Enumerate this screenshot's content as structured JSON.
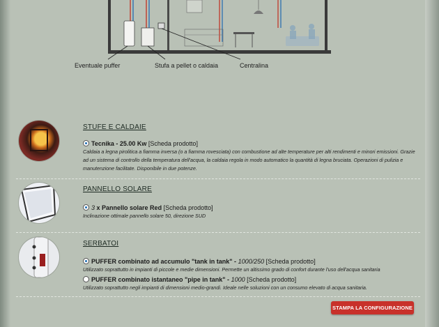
{
  "diagram": {
    "callouts": [
      "Eventuale puffer",
      "Stufa a pellet o caldaia",
      "Centralina"
    ]
  },
  "sections": [
    {
      "title": "STUFE E CALDAIE",
      "options": [
        {
          "selected": true,
          "name": "Tecnika - 25.00 Kw",
          "link": "[Scheda prodotto]",
          "description": "Caldaia a legna pirolitica a fiamma inversa (o a fiamma rovesciata) con combustione ad alte temperature per alti rendimenti e minori emissioni. Grazie ad un sistema di controllo della temperatura dell'acqua, la caldaia regola in modo automatico la quantità di legna bruciata. Operazioni di pulizia e manutenzione facilitate. Disponibile in due potenze."
        }
      ]
    },
    {
      "title": "PANNELLO SOLARE",
      "options": [
        {
          "selected": true,
          "qty": "3",
          "name": "x Pannello solare Red",
          "link": "[Scheda prodotto]",
          "description": "Inclinazione ottimale pannello solare 50, direzione SUD"
        }
      ]
    },
    {
      "title": "SERBATOI",
      "options": [
        {
          "selected": true,
          "name": "PUFFER combinato ad accumulo \"tank in tank\" -",
          "size": "1000/250",
          "link": "[Scheda prodotto]",
          "description": "Utilizzato soprattutto in impianti di piccole e medie dimensioni. Permette un altissimo grado di confort durante l'uso dell'acqua sanitaria"
        },
        {
          "selected": false,
          "name": "PUFFER combinato istantaneo \"pipe in tank\" -",
          "size": "1000",
          "link": "[Scheda prodotto]",
          "description": "Utilizzato soprattutto negli impianti di dimensioni medio-grandi. Ideale nelle soluzioni con un consumo elevato di acqua sanitaria."
        }
      ]
    }
  ],
  "print_button": "STAMPA LA CONFIGURAZIONE",
  "colors": {
    "panel": "#b9c1b6",
    "button": "#c8312a",
    "radio_dot": "#1f6fb5"
  }
}
